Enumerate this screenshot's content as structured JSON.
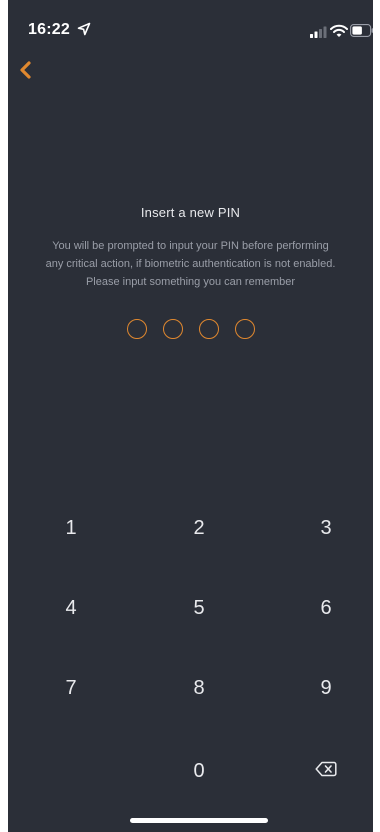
{
  "status_bar": {
    "time": "16:22",
    "icons": [
      "location-arrow-icon",
      "signal-icon",
      "wifi-icon",
      "battery-icon"
    ]
  },
  "nav": {
    "back_icon": "chevron-left-icon"
  },
  "content": {
    "title": "Insert a new PIN",
    "description_lines": [
      "You will be prompted to input your PIN before performing",
      "any critical action, if biometric authentication is not enabled.",
      "Please input something you can remember"
    ],
    "pin_length": 4,
    "pin_entered": 0
  },
  "keypad": {
    "keys": [
      "1",
      "2",
      "3",
      "4",
      "5",
      "6",
      "7",
      "8",
      "9",
      "0"
    ],
    "delete_icon": "backspace-icon"
  },
  "colors": {
    "background": "#2b2f38",
    "accent": "#e0882f",
    "text_primary": "#e9eaed",
    "text_secondary": "#9a9ea8"
  }
}
